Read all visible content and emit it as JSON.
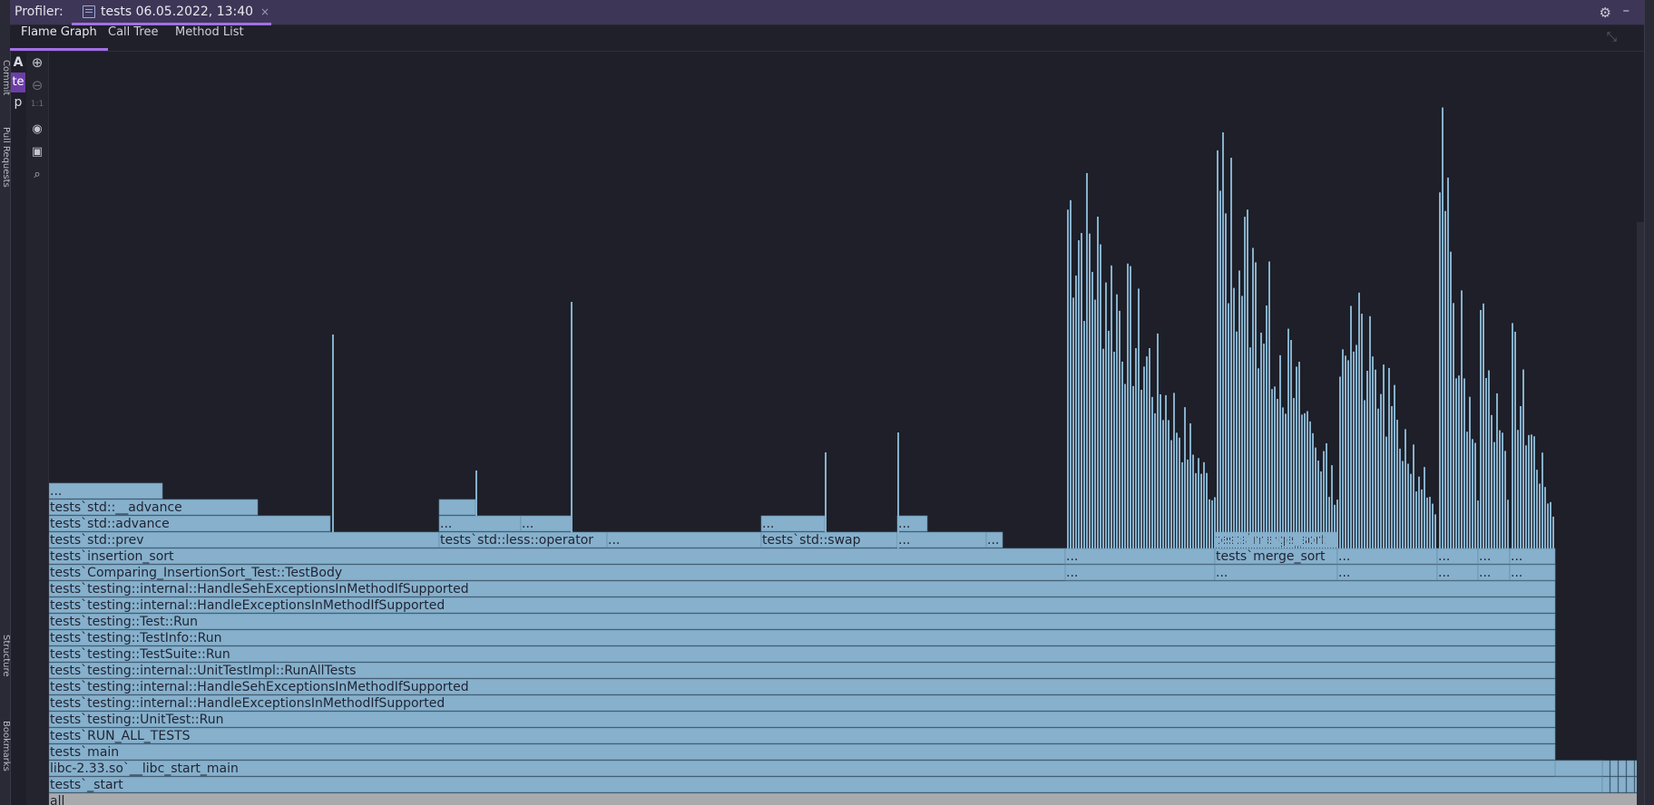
{
  "header": {
    "title": "Profiler:",
    "tab_label": "tests 06.05.2022, 13:40",
    "tab_close": "×",
    "settings_icon": "gear-icon",
    "hide_icon": "minimize-icon"
  },
  "left_strip": {
    "labels": [
      "Commit",
      "Pull Requests",
      "Structure",
      "Bookmarks"
    ]
  },
  "project_column": {
    "items": [
      "A",
      "te",
      "p"
    ],
    "active_index": 1
  },
  "view_tabs": [
    {
      "label": "Flame Graph",
      "active": true
    },
    {
      "label": "Call Tree",
      "active": false
    },
    {
      "label": "Method List",
      "active": false
    }
  ],
  "toolbar": {
    "zoom_in_icon": "zoom-in-icon",
    "zoom_out_icon": "zoom-out-icon",
    "actual_size_label": "1:1",
    "view_icon": "eye-icon",
    "capture_icon": "camera-icon",
    "search_icon": "search-icon"
  },
  "colors": {
    "frame_fill": "#86b0cc",
    "frame_border": "#5f8aa6",
    "root_fill": "#a9aaac",
    "background": "#1e1f28",
    "accent": "#a36fe6",
    "header_bg": "#3d3657"
  },
  "flame_graph": {
    "root_label": "all",
    "stack": [
      "tests`_start",
      "libc-2.33.so`__libc_start_main",
      "tests`main",
      "tests`RUN_ALL_TESTS",
      "tests`testing::UnitTest::Run",
      "tests`testing::internal::HandleExceptionsInMethodIfSupported",
      "tests`testing::internal::HandleSehExceptionsInMethodIfSupported",
      "tests`testing::internal::UnitTestImpl::RunAllTests",
      "tests`testing::TestSuite::Run",
      "tests`testing::TestInfo::Run",
      "tests`testing::Test::Run",
      "tests`testing::internal::HandleExceptionsInMethodIfSupported",
      "tests`testing::internal::HandleSehExceptionsInMethodIfSupported",
      "tests`Comparing_InsertionSort_Test::TestBody"
    ],
    "insertion_frames": [
      "tests`insertion_sort",
      "tests`std::prev",
      "tests`std::advance",
      "tests`std::__advance",
      "..."
    ],
    "other_frames": {
      "less_operator": "tests`std::less::operator",
      "swap": "tests`std::swap",
      "merge_sort": "tests`merge_sort",
      "ellipsis": "..."
    }
  }
}
